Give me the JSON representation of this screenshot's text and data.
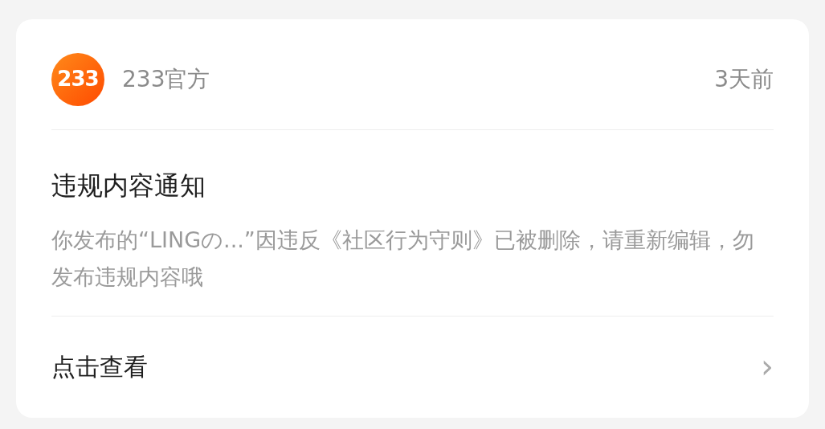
{
  "notice": {
    "sender": {
      "logo_text": "233",
      "name": "233官方"
    },
    "time": "3天前",
    "title": "违规内容通知",
    "message": "你发布的“LINGの...”因违反《社区行为守则》已被删除，请重新编辑，勿发布违规内容哦",
    "action": {
      "label": "点击查看",
      "icon": "›"
    }
  }
}
